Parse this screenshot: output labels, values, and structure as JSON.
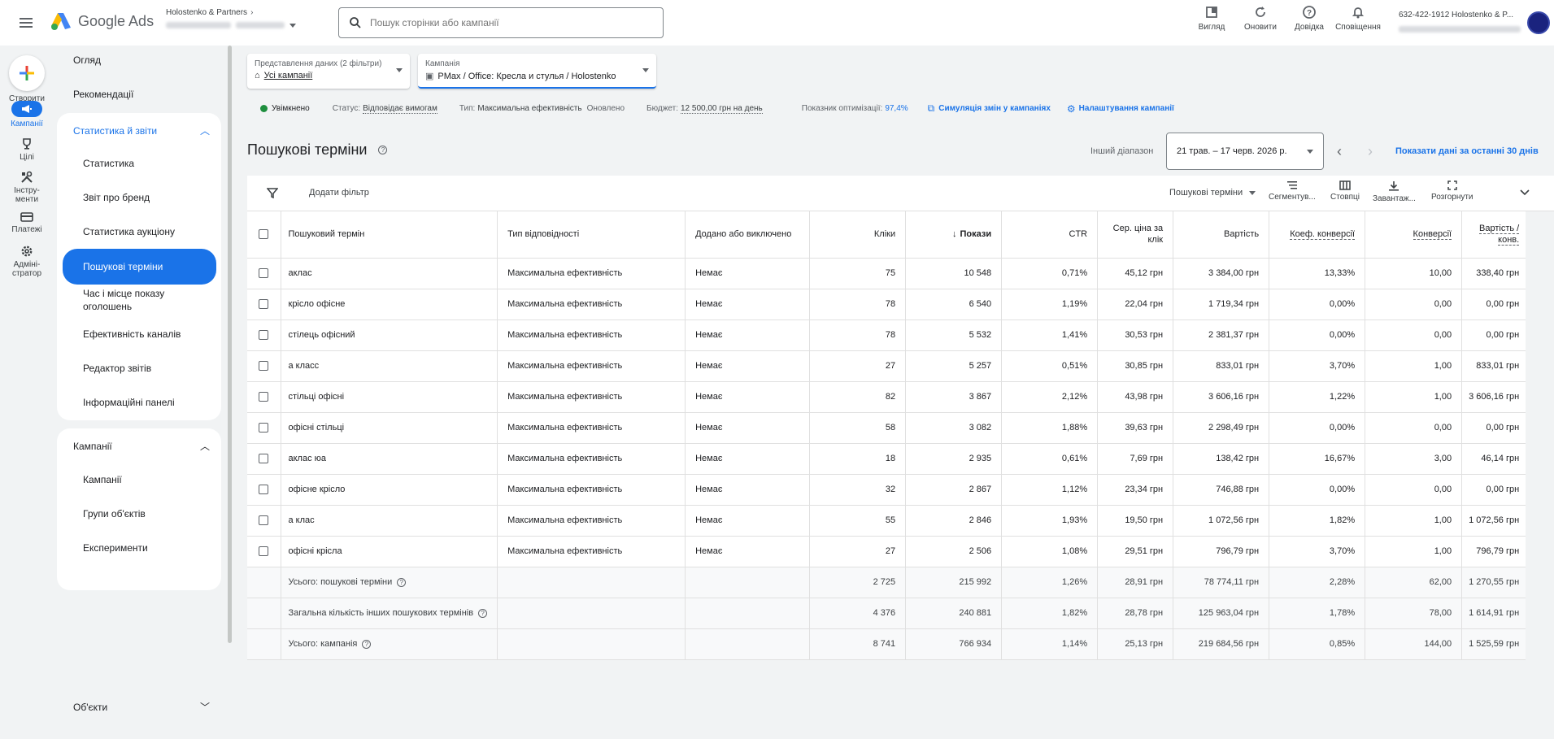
{
  "app": {
    "name": "Google Ads",
    "account_name": "Holostenko & Partners",
    "account_number": "632-422-1912 Holostenko & P..."
  },
  "search": {
    "placeholder": "Пошук сторінки або кампанії"
  },
  "top_actions": [
    {
      "label": "Вигляд",
      "icon": "view-icon"
    },
    {
      "label": "Оновити",
      "icon": "refresh-icon"
    },
    {
      "label": "Довідка",
      "icon": "help-icon"
    },
    {
      "label": "Сповіщення",
      "icon": "bell-icon"
    }
  ],
  "rail": {
    "create": "Створити",
    "items": [
      {
        "label": "Кампанії",
        "icon": "megaphone-icon",
        "active": true
      },
      {
        "label": "Цілі",
        "icon": "trophy-icon"
      },
      {
        "label": "Інстру-\nменти",
        "icon": "tools-icon"
      },
      {
        "label": "Платежі",
        "icon": "card-icon"
      },
      {
        "label": "Адміні-\nстратор",
        "icon": "gear-icon"
      }
    ]
  },
  "sidenav": {
    "overview": "Огляд",
    "recommendations": "Рекомендації",
    "reports_section": "Статистика й звіти",
    "reports_items": [
      "Статистика",
      "Звіт про бренд",
      "Статистика аукціону",
      "Пошукові терміни",
      "Час і місце показу оголошень",
      "Ефективність каналів",
      "Редактор звітів",
      "Інформаційні панелі"
    ],
    "campaigns_section": "Кампанії",
    "campaigns_items": [
      "Кампанії",
      "Групи об'єктів",
      "Експерименти"
    ],
    "assets_section": "Об'єкти"
  },
  "filters": {
    "view_caption": "Представлення даних (2 фільтри)",
    "view_value": "Усі кампанії",
    "campaign_caption": "Кампанія",
    "campaign_value": "PMax / Office: Кресла и стулья / Holostenko"
  },
  "status": {
    "enabled": "Увімкнено",
    "status_label": "Статус:",
    "status_value": "Відповідає вимогам",
    "type_label": "Тип:",
    "type_value": "Максимальна ефективність",
    "updated": "Оновлено",
    "budget_label": "Бюджет:",
    "budget_value": "12 500,00 грн на день",
    "optimization_label": "Показник оптимізації:",
    "optimization_value": "97,4%",
    "simulation": "Симуляція змін у кампаніях",
    "settings": "Налаштування кампанії"
  },
  "page": {
    "title": "Пошукові терміни",
    "range_label": "Інший діапазон",
    "date_range": "21 трав. – 17 черв. 2026 р.",
    "show_30": "Показати дані за останні 30 днів"
  },
  "toolbar": {
    "add_filter": "Додати фільтр",
    "view_select": "Пошукові терміни",
    "segment": "Сегментув...",
    "columns": "Стовпці",
    "download": "Завантаж...",
    "expand": "Розгорнути"
  },
  "table": {
    "headers": [
      "Пошуковий термін",
      "Тип відповідності",
      "Додано або виключено",
      "Кліки",
      "Покази",
      "CTR",
      "Сер. ціна за клік",
      "Вартість",
      "Коеф. конверсії",
      "Конверсії",
      "Вартість / конв."
    ],
    "rows": [
      [
        "аклас",
        "Максимальна ефективність",
        "Немає",
        "75",
        "10 548",
        "0,71%",
        "45,12 грн",
        "3 384,00 грн",
        "13,33%",
        "10,00",
        "338,40 грн"
      ],
      [
        "крісло офісне",
        "Максимальна ефективність",
        "Немає",
        "78",
        "6 540",
        "1,19%",
        "22,04 грн",
        "1 719,34 грн",
        "0,00%",
        "0,00",
        "0,00 грн"
      ],
      [
        "стілець офісний",
        "Максимальна ефективність",
        "Немає",
        "78",
        "5 532",
        "1,41%",
        "30,53 грн",
        "2 381,37 грн",
        "0,00%",
        "0,00",
        "0,00 грн"
      ],
      [
        "а класс",
        "Максимальна ефективність",
        "Немає",
        "27",
        "5 257",
        "0,51%",
        "30,85 грн",
        "833,01 грн",
        "3,70%",
        "1,00",
        "833,01 грн"
      ],
      [
        "стільці офісні",
        "Максимальна ефективність",
        "Немає",
        "82",
        "3 867",
        "2,12%",
        "43,98 грн",
        "3 606,16 грн",
        "1,22%",
        "1,00",
        "3 606,16 грн"
      ],
      [
        "офісні стільці",
        "Максимальна ефективність",
        "Немає",
        "58",
        "3 082",
        "1,88%",
        "39,63 грн",
        "2 298,49 грн",
        "0,00%",
        "0,00",
        "0,00 грн"
      ],
      [
        "аклас юа",
        "Максимальна ефективність",
        "Немає",
        "18",
        "2 935",
        "0,61%",
        "7,69 грн",
        "138,42 грн",
        "16,67%",
        "3,00",
        "46,14 грн"
      ],
      [
        "офісне крісло",
        "Максимальна ефективність",
        "Немає",
        "32",
        "2 867",
        "1,12%",
        "23,34 грн",
        "746,88 грн",
        "0,00%",
        "0,00",
        "0,00 грн"
      ],
      [
        "а клас",
        "Максимальна ефективність",
        "Немає",
        "55",
        "2 846",
        "1,93%",
        "19,50 грн",
        "1 072,56 грн",
        "1,82%",
        "1,00",
        "1 072,56 грн"
      ],
      [
        "офісні крісла",
        "Максимальна ефективність",
        "Немає",
        "27",
        "2 506",
        "1,08%",
        "29,51 грн",
        "796,79 грн",
        "3,70%",
        "1,00",
        "796,79 грн"
      ]
    ],
    "totals": [
      [
        "Усього: пошукові терміни",
        "2 725",
        "215 992",
        "1,26%",
        "28,91 грн",
        "78 774,11 грн",
        "2,28%",
        "62,00",
        "1 270,55 грн"
      ],
      [
        "Загальна кількість інших пошукових термінів",
        "4 376",
        "240 881",
        "1,82%",
        "28,78 грн",
        "125 963,04 грн",
        "1,78%",
        "78,00",
        "1 614,91 грн"
      ],
      [
        "Усього: кампанія",
        "8 741",
        "766 934",
        "1,14%",
        "25,13 грн",
        "219 684,56 грн",
        "0,85%",
        "144,00",
        "1 525,59 грн"
      ]
    ]
  },
  "colors": {
    "accent": "#1a73e8",
    "status_green": "#1e8e3e"
  }
}
